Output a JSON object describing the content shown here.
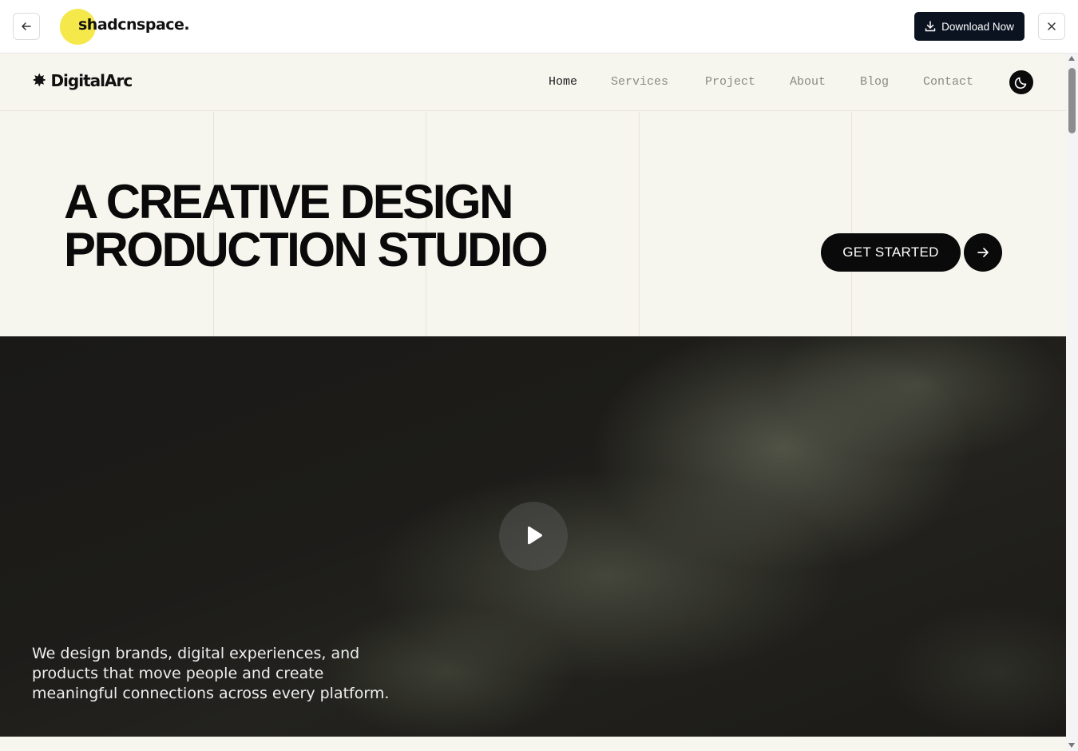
{
  "topbar": {
    "brand": "shadcnspace.",
    "download_label": "Download Now"
  },
  "site": {
    "logo": "DigitalArc",
    "nav": [
      "Home",
      "Services",
      "Project",
      "About",
      "Blog",
      "Contact"
    ],
    "active_nav": "Home",
    "headline_line1": "A CREATIVE DESIGN",
    "headline_line2": "PRODUCTION STUDIO",
    "cta_label": "GET STARTED",
    "video_caption": "We design brands, digital experiences, and products that move people and create meaningful connections across every platform."
  },
  "colors": {
    "accent": "#f5e84a",
    "page_bg": "#f7f6ee",
    "dark": "#0a0a0a",
    "download_bg": "#0b1220"
  },
  "icons": {
    "back": "arrow-left-icon",
    "download": "download-icon",
    "close": "close-icon",
    "logo": "asterisk-icon",
    "theme": "moon-icon",
    "cta": "arrow-right-icon",
    "play": "play-icon"
  }
}
